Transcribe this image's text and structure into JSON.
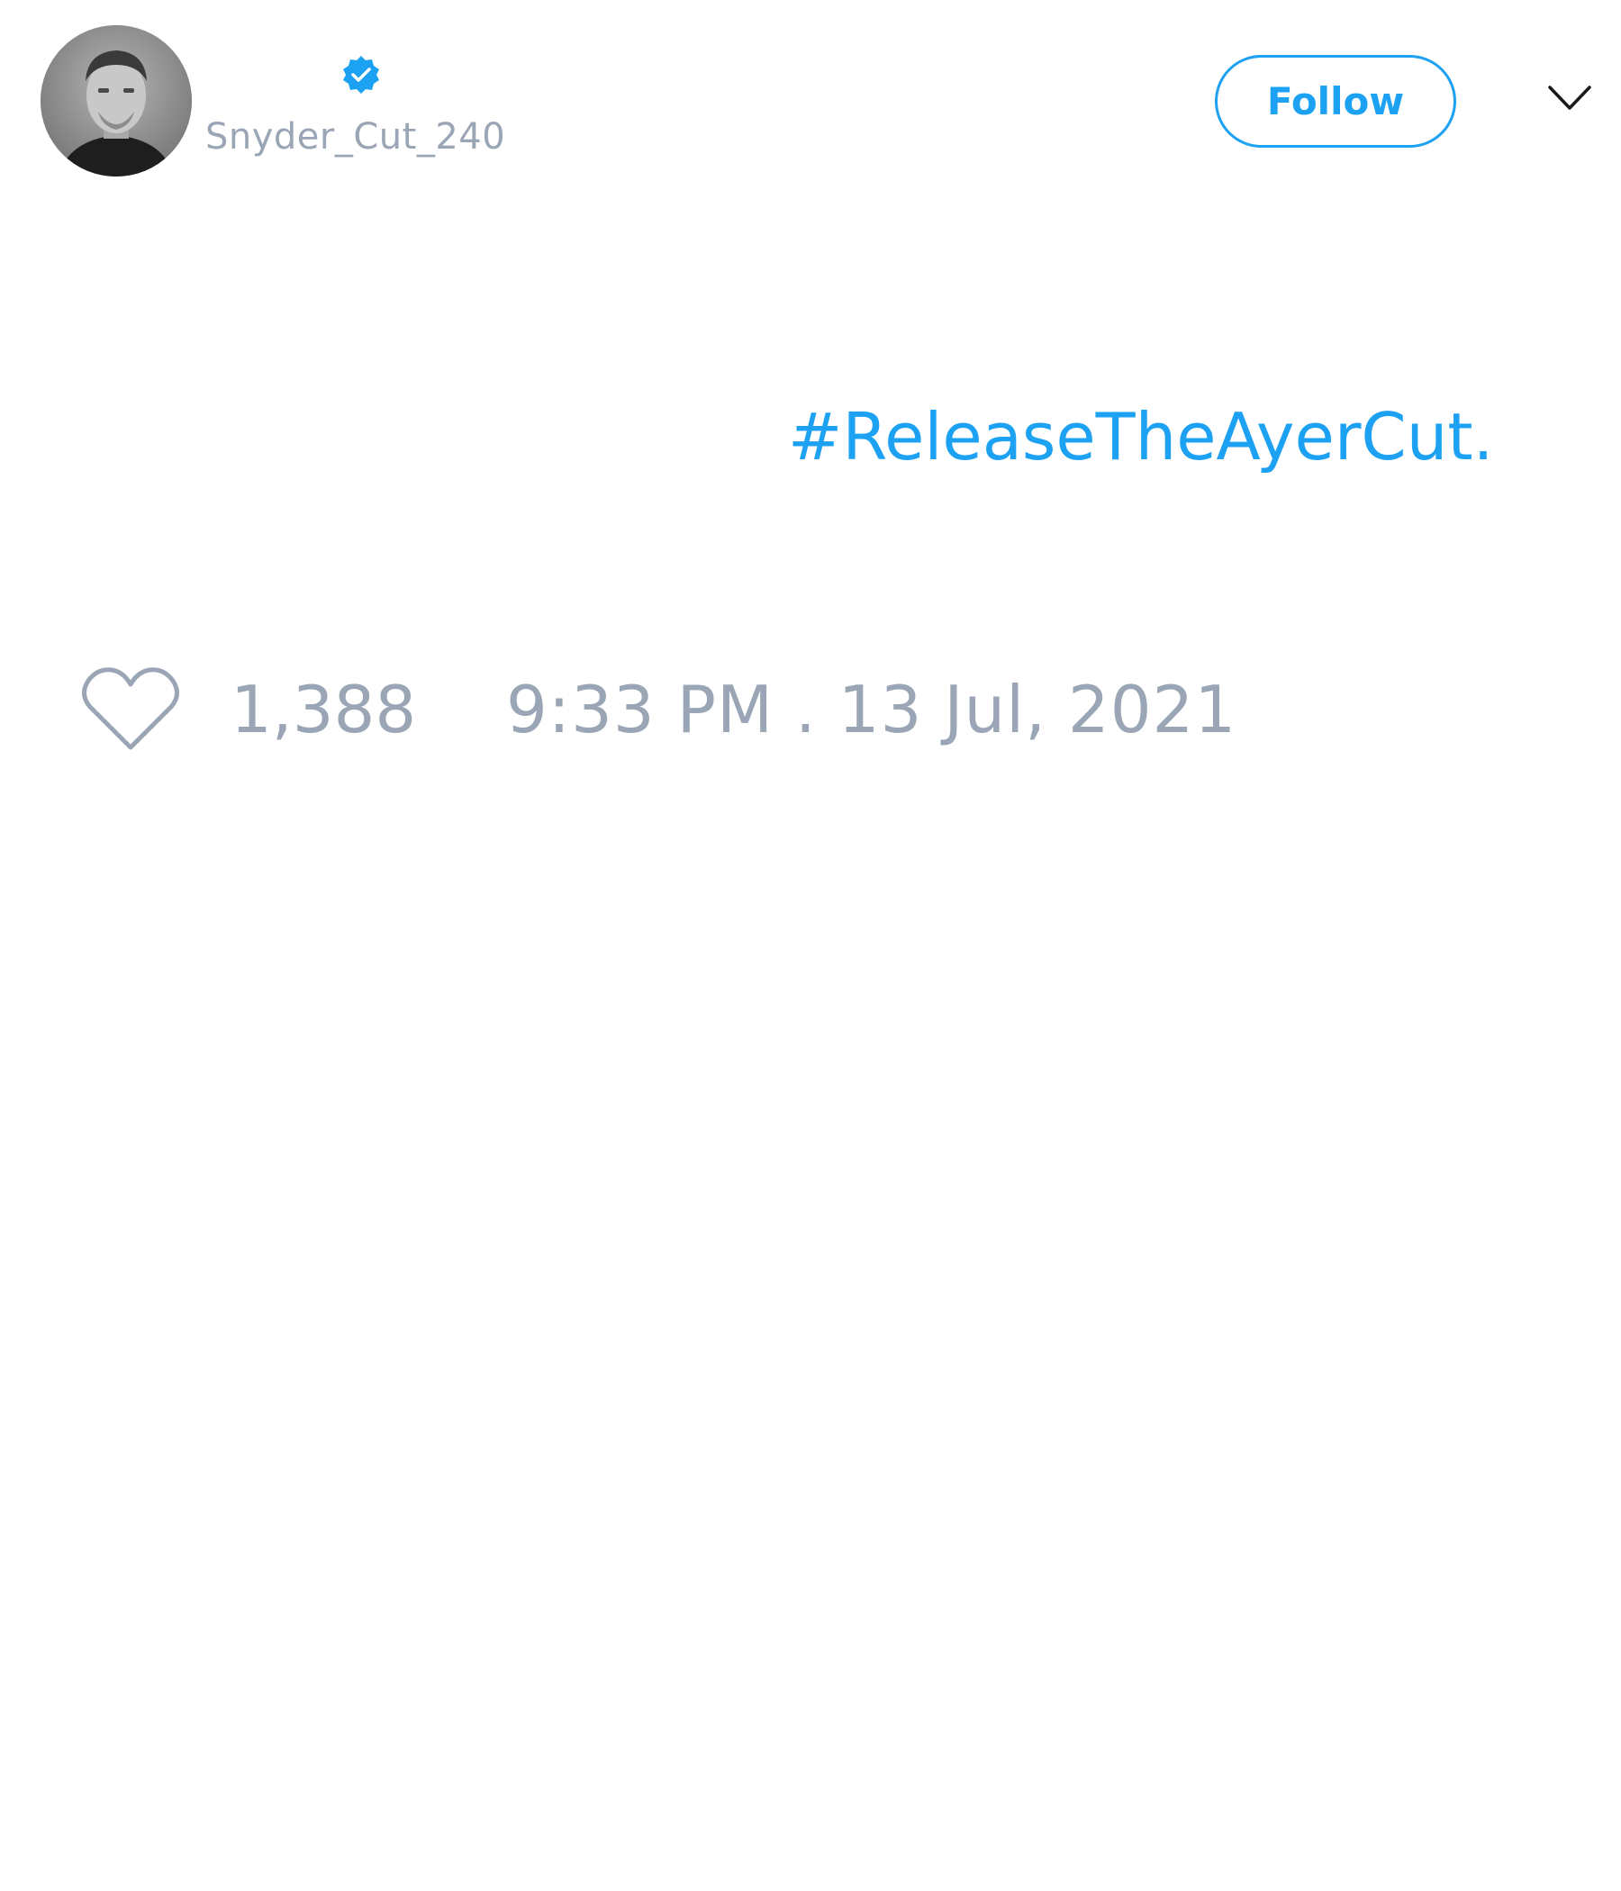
{
  "user": {
    "avatar": "profile-photo",
    "verified_icon": "verified-badge-icon",
    "handle": "Snyder_Cut_240"
  },
  "actions": {
    "follow_label": "Follow",
    "menu_icon": "chevron-down-icon"
  },
  "tweet": {
    "hashtag": "#ReleaseTheAyerCut."
  },
  "stats": {
    "like_icon": "heart-icon",
    "likes": "1,388",
    "timestamp": "9:33 PM . 13 Jul, 2021"
  },
  "colors": {
    "accent": "#1da1f2",
    "muted_text": "#9aa6b6",
    "background": "#ffffff"
  }
}
